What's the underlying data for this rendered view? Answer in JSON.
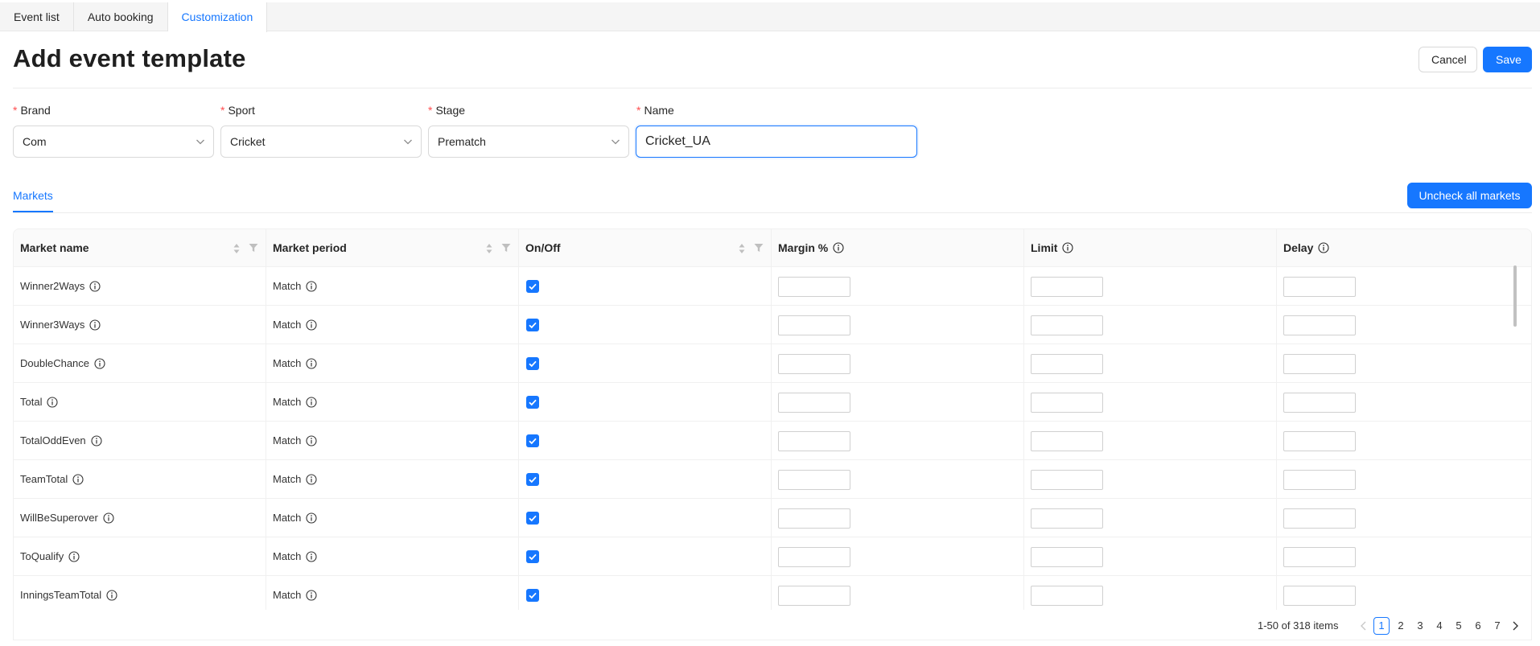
{
  "tabs": [
    "Event list",
    "Auto booking",
    "Customization"
  ],
  "active_tab": "Customization",
  "page": {
    "title": "Add event template",
    "cancel_label": "Cancel",
    "save_label": "Save"
  },
  "form": {
    "brand": {
      "label": "Brand",
      "value": "Com"
    },
    "sport": {
      "label": "Sport",
      "value": "Cricket"
    },
    "stage": {
      "label": "Stage",
      "value": "Prematch"
    },
    "name": {
      "label": "Name",
      "value": "Cricket_UA"
    },
    "required_mark": "*"
  },
  "markets": {
    "tab_label": "Markets",
    "uncheck_all_label": "Uncheck all markets"
  },
  "table": {
    "columns": [
      "Market name",
      "Market period",
      "On/Off",
      "Margin %",
      "Limit",
      "Delay"
    ],
    "rows": [
      {
        "market": "Winner2Ways",
        "period": "Match",
        "on": true
      },
      {
        "market": "Winner3Ways",
        "period": "Match",
        "on": true
      },
      {
        "market": "DoubleChance",
        "period": "Match",
        "on": true
      },
      {
        "market": "Total",
        "period": "Match",
        "on": true
      },
      {
        "market": "TotalOddEven",
        "period": "Match",
        "on": true
      },
      {
        "market": "TeamTotal",
        "period": "Match",
        "on": true
      },
      {
        "market": "WillBeSuperover",
        "period": "Match",
        "on": true
      },
      {
        "market": "ToQualify",
        "period": "Match",
        "on": true
      },
      {
        "market": "InningsTeamTotal",
        "period": "Match",
        "on": true
      }
    ]
  },
  "pagination": {
    "total_text": "1-50 of 318 items",
    "pages": [
      "1",
      "2",
      "3",
      "4",
      "5",
      "6",
      "7"
    ],
    "current": "1"
  },
  "colors": {
    "primary": "#1677ff",
    "required": "#ff4d4f"
  }
}
